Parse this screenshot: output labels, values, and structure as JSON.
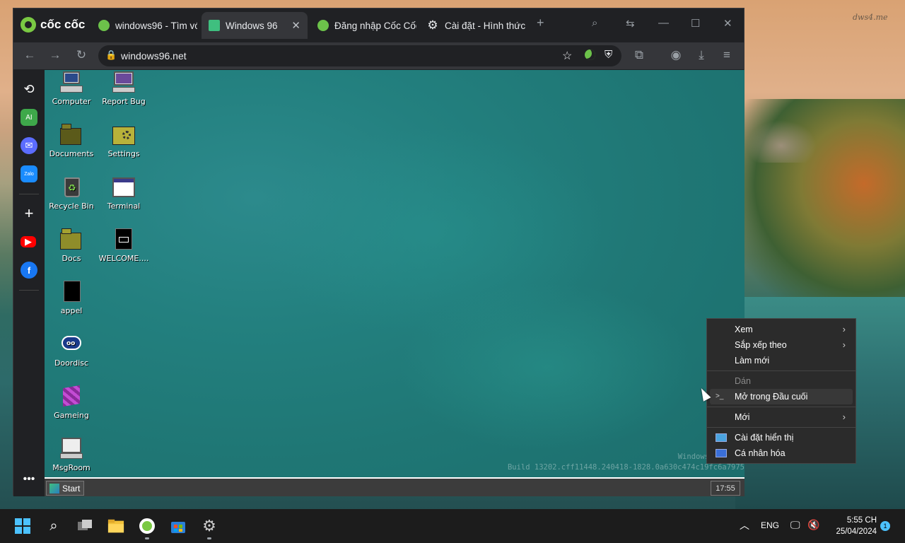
{
  "watermark": "dws4.me",
  "browser": {
    "brand": "cốc cốc",
    "tabs": [
      {
        "label": "windows96 - Tìm vớ",
        "icon": "coccoc-favicon"
      },
      {
        "label": "Windows 96",
        "icon": "windows96-favicon",
        "active": true
      },
      {
        "label": "Đăng nhập Cốc Cốc",
        "icon": "coccoc-favicon"
      },
      {
        "label": "Cài đặt - Hình thức",
        "icon": "gear-icon"
      }
    ],
    "url": "windows96.net"
  },
  "sidebar": {
    "items": [
      "history-icon",
      "ai-icon",
      "messenger-icon",
      "zalo-icon",
      "add-icon",
      "youtube-icon",
      "facebook-icon",
      "more-icon"
    ],
    "ai_label": "AI",
    "zalo_label": "Zalo"
  },
  "desktop": {
    "icons": [
      {
        "label": "Computer"
      },
      {
        "label": "Report Bug"
      },
      {
        "label": "Documents"
      },
      {
        "label": "Settings"
      },
      {
        "label": "Recycle Bin"
      },
      {
        "label": "Terminal"
      },
      {
        "label": "Docs"
      },
      {
        "label": "WELCOME...."
      },
      {
        "label": "appel"
      },
      {
        "label": "Doordisc"
      },
      {
        "label": "Gameing"
      },
      {
        "label": "MsgRoom"
      }
    ],
    "build_title": "Windows",
    "build_info": "Build 13202.cff11448.240418-1828.0a630c474c19fc6a7975",
    "start_label": "Start",
    "clock": "17:55"
  },
  "context_menu": {
    "items": [
      {
        "label": "Xem",
        "submenu": true
      },
      {
        "label": "Sắp xếp theo",
        "submenu": true
      },
      {
        "label": "Làm mới"
      },
      {
        "label": "Dán",
        "disabled": true
      },
      {
        "label": "Mở trong Đầu cuối",
        "icon": "terminal-icon"
      },
      {
        "label": "Mới",
        "submenu": true
      },
      {
        "label": "Cài đặt hiển thị",
        "icon": "display-icon"
      },
      {
        "label": "Cá nhân hóa",
        "icon": "personalize-icon"
      }
    ]
  },
  "taskbar": {
    "language": "ENG",
    "time": "5:55 CH",
    "date": "25/04/2024",
    "notification_count": "1"
  }
}
